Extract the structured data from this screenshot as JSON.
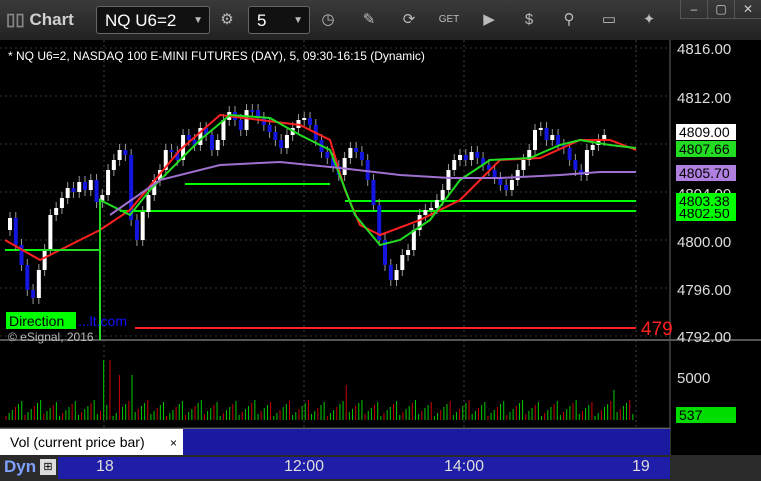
{
  "toolbar": {
    "title": "Chart",
    "symbol": "NQ U6=2",
    "interval": "5"
  },
  "chart": {
    "header": "* NQ U6=2, NASDAQ 100 E-MINI FUTURES (DAY), 5, 09:30-16:15 (Dynamic)",
    "watermark_brand": "Direction",
    "watermark_url": "...lt.com",
    "copyright": "© eSignal, 2016",
    "price_axis": [
      "4816.00",
      "4812.00",
      "4800.00",
      "4796.00",
      "4792.00"
    ],
    "price_axis_partial": "4804.00",
    "labels": {
      "last": "4809.00",
      "ma_green": "4807.66",
      "ma_purple": "4805.70",
      "level_1": "4803.38",
      "level_2": "4802.50",
      "red_level_text": "479"
    },
    "volume_axis": "5000",
    "volume_label": "537",
    "volume_tab": "Vol (current price bar)",
    "volume_tab_close": "×",
    "time_axis": [
      "18",
      "12:00",
      "14:00",
      "19"
    ],
    "bottom_left": "Dyn",
    "colors": {
      "candle_up": "#ffffff",
      "candle_down": "#1515e0",
      "ma_red": "#ff2020",
      "ma_green": "#22dd22",
      "ma_purple": "#a070d0",
      "level_green": "#00ff00",
      "volume_up": "#00cc00",
      "volume_down": "#cc0000"
    }
  }
}
